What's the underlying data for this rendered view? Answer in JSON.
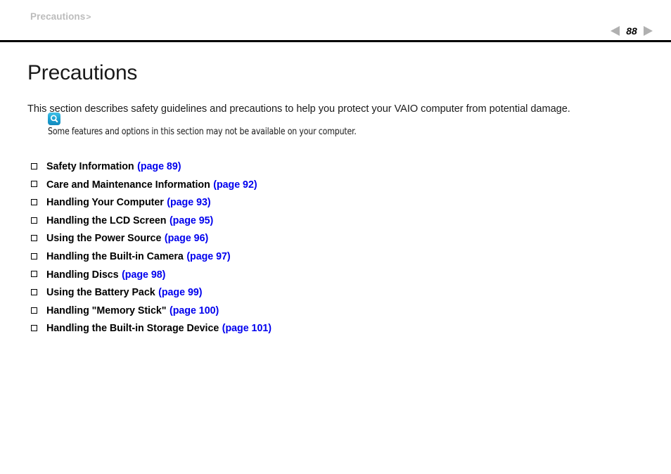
{
  "header": {
    "breadcrumb_text": "Precautions",
    "breadcrumb_separator": ">",
    "page_number": "88",
    "prev_arrow_icon": "triangle-left-icon",
    "next_arrow_icon": "triangle-right-icon"
  },
  "main": {
    "title": "Precautions",
    "intro": "This section describes safety guidelines and precautions to help you protect your VAIO computer from potential damage.",
    "note": {
      "icon": "magnifier-note-icon",
      "text": "Some features and options in this section may not be available on your computer."
    },
    "bullet_icon": "empty-square-bullet-icon",
    "toc_items": [
      {
        "label": "Safety Information",
        "page_ref": "(page 89)"
      },
      {
        "label": "Care and Maintenance Information",
        "page_ref": "(page 92)"
      },
      {
        "label": "Handling Your Computer",
        "page_ref": "(page 93)"
      },
      {
        "label": "Handling the LCD Screen",
        "page_ref": "(page 95)"
      },
      {
        "label": "Using the Power Source",
        "page_ref": "(page 96)"
      },
      {
        "label": "Handling the Built-in Camera",
        "page_ref": "(page 97)"
      },
      {
        "label": "Handling Discs",
        "page_ref": "(page 98)"
      },
      {
        "label": "Using the Battery Pack",
        "page_ref": "(page 99)"
      },
      {
        "label": "Handling \"Memory Stick\"",
        "page_ref": "(page 100)"
      },
      {
        "label": "Handling the Built-in Storage Device",
        "page_ref": "(page 101)"
      }
    ]
  },
  "colors": {
    "link_blue": "#0000ee",
    "breadcrumb_gray": "#bcbcbc",
    "arrow_gray": "#b0b0b0",
    "note_icon_cyan": "#1a9fd0",
    "rule_black": "#000000"
  }
}
